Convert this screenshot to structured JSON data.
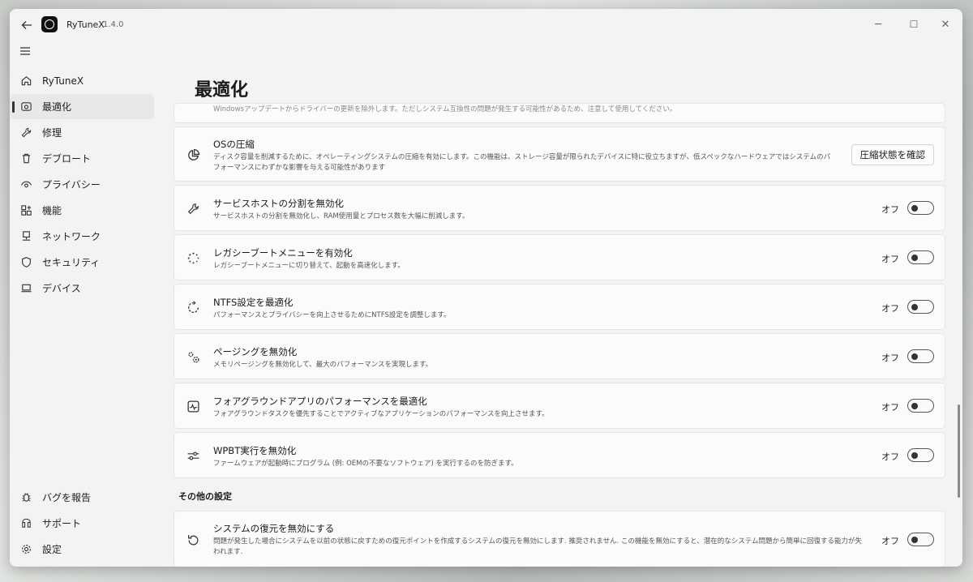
{
  "window": {
    "app_name": "RyTuneX",
    "version": "1.4.0",
    "controls": {
      "minimize": "─",
      "maximize": "☐",
      "close": "✕"
    }
  },
  "sidebar": {
    "items": [
      {
        "label": "RyTuneX",
        "icon": "home-icon"
      },
      {
        "label": "最適化",
        "icon": "gauge-icon",
        "active": true
      },
      {
        "label": "修理",
        "icon": "wrench-icon"
      },
      {
        "label": "デブロート",
        "icon": "trash-icon"
      },
      {
        "label": "プライバシー",
        "icon": "eye-icon"
      },
      {
        "label": "機能",
        "icon": "grid-add-icon"
      },
      {
        "label": "ネットワーク",
        "icon": "network-icon"
      },
      {
        "label": "セキュリティ",
        "icon": "shield-icon"
      },
      {
        "label": "デバイス",
        "icon": "laptop-icon"
      }
    ],
    "bottom_items": [
      {
        "label": "バグを報告",
        "icon": "bug-icon"
      },
      {
        "label": "サポート",
        "icon": "support-icon"
      },
      {
        "label": "設定",
        "icon": "gear-icon"
      }
    ]
  },
  "main": {
    "title": "最適化",
    "partial_top_desc": "Windowsアップデートからドライバーの更新を除外します。ただしシステム互換性の問題が発生する可能性があるため、注意して使用してください。",
    "settings": [
      {
        "title": "OSの圧縮",
        "desc": "ディスク容量を削減するために、オペレーティングシステムの圧縮を有効にします。この機能は、ストレージ容量が限られたデバイスに特に役立ちますが、低スペックなハードウェアではシステムのパフォーマンスにわずかな影響を与える可能性があります",
        "button": "圧縮状態を確認",
        "icon": "pie-chart-icon"
      },
      {
        "title": "サービスホストの分割を無効化",
        "desc": "サービスホストの分割を無効化し、RAM使用量とプロセス数を大幅に削減します。",
        "state": "オフ",
        "icon": "wrench-icon"
      },
      {
        "title": "レガシーブートメニューを有効化",
        "desc": "レガシーブートメニューに切り替えて、起動を高速化します。",
        "state": "オフ",
        "icon": "spinner-icon"
      },
      {
        "title": "NTFS設定を最適化",
        "desc": "パフォーマンスとプライバシーを向上させるためにNTFS設定を調整します。",
        "state": "オフ",
        "icon": "refresh-dashed-icon"
      },
      {
        "title": "ページングを無効化",
        "desc": "メモリページングを無効化して、最大のパフォーマンスを実現します。",
        "state": "オフ",
        "icon": "gears-icon"
      },
      {
        "title": "フォアグラウンドアプリのパフォーマンスを最適化",
        "desc": "フォアグラウンドタスクを優先することでアクティブなアプリケーションのパフォーマンスを向上させます。",
        "state": "オフ",
        "icon": "pulse-icon"
      },
      {
        "title": "WPBT実行を無効化",
        "desc": "ファームウェアが起動時にプログラム (例: OEMの不要なソフトウェア) を実行するのを防ぎます。",
        "state": "オフ",
        "icon": "sliders-icon"
      }
    ],
    "section_other": "その他の設定",
    "other_settings": [
      {
        "title": "システムの復元を無効にする",
        "desc": "問題が発生した場合にシステムを以前の状態に戻すための復元ポイントを作成するシステムの復元を無効にします. 推奨されません. この機能を無効にすると、潜在的なシステム問題から簡単に回復する能力が失われます.",
        "state": "オフ",
        "icon": "restore-icon"
      }
    ]
  }
}
